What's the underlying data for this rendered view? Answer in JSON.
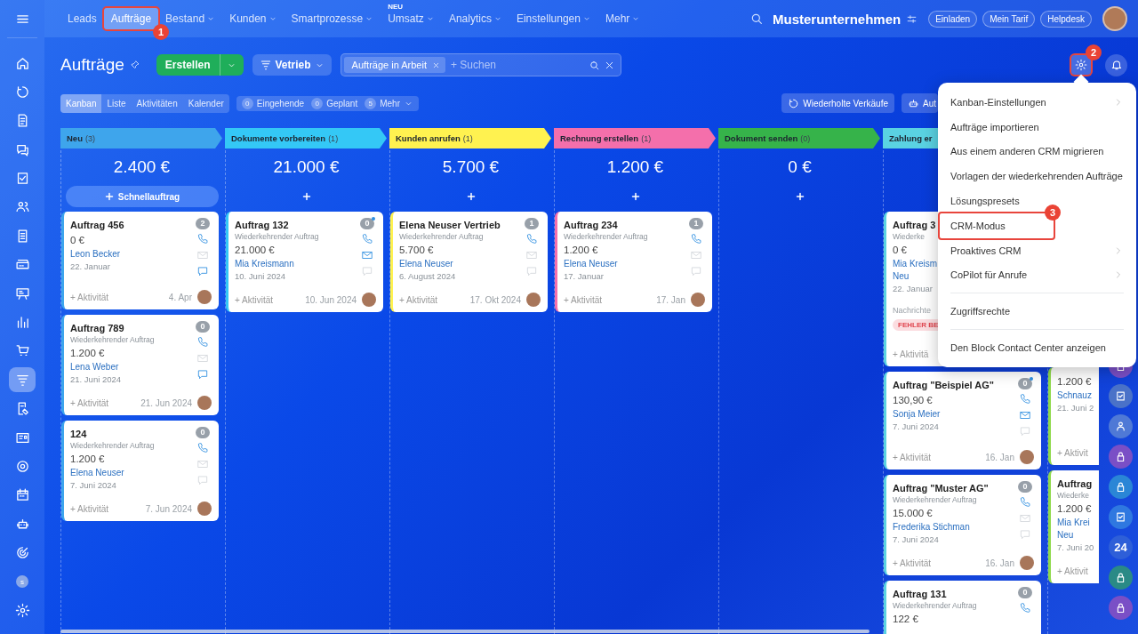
{
  "nav": {
    "items": [
      {
        "label": "Leads",
        "selected": false,
        "dropdown": false
      },
      {
        "label": "Aufträge",
        "selected": true,
        "dropdown": false,
        "callout": "1"
      },
      {
        "label": "Bestand",
        "selected": false,
        "dropdown": true
      },
      {
        "label": "Kunden",
        "selected": false,
        "dropdown": true
      },
      {
        "label": "Smartprozesse",
        "selected": false,
        "dropdown": true
      },
      {
        "label": "Umsatz",
        "selected": false,
        "dropdown": true,
        "badge": "NEU"
      },
      {
        "label": "Analytics",
        "selected": false,
        "dropdown": true
      },
      {
        "label": "Einstellungen",
        "selected": false,
        "dropdown": true
      },
      {
        "label": "Mehr",
        "selected": false,
        "dropdown": true
      }
    ],
    "company": "Musterunternehmen",
    "buttons": [
      "Einladen",
      "Mein Tarif",
      "Helpdesk"
    ]
  },
  "sidebar": {
    "items": [
      {
        "kind": "home",
        "selected": false
      },
      {
        "kind": "cycle",
        "selected": false
      },
      {
        "kind": "document",
        "selected": false
      },
      {
        "kind": "chat",
        "selected": false
      },
      {
        "kind": "checkbox",
        "selected": false
      },
      {
        "kind": "people",
        "selected": false
      },
      {
        "kind": "page",
        "selected": false
      },
      {
        "kind": "drive",
        "selected": false
      },
      {
        "kind": "board",
        "selected": false
      },
      {
        "kind": "chart",
        "selected": false
      },
      {
        "kind": "cart",
        "selected": false
      },
      {
        "kind": "funnel",
        "selected": true
      },
      {
        "kind": "edit",
        "selected": false
      },
      {
        "kind": "contact",
        "selected": false
      },
      {
        "kind": "ring",
        "selected": false
      },
      {
        "kind": "calendar",
        "selected": false
      },
      {
        "kind": "robot",
        "selected": false
      },
      {
        "kind": "target",
        "selected": false
      },
      {
        "kind": "initial",
        "selected": false,
        "text": "s"
      },
      {
        "kind": "settings",
        "selected": false
      }
    ]
  },
  "page": {
    "title": "Aufträge",
    "create": "Erstellen",
    "pipeline": "Vetrieb",
    "filter_chip": "Aufträge in Arbeit",
    "search": {
      "placeholder": "+ Suchen"
    },
    "settings_callout": "2"
  },
  "views": [
    {
      "label": "Kanban",
      "selected": true
    },
    {
      "label": "Liste",
      "selected": false
    },
    {
      "label": "Aktivitäten",
      "selected": false
    },
    {
      "label": "Kalender",
      "selected": false
    }
  ],
  "counters": [
    {
      "count": "0",
      "label": "Eingehende",
      "dropdown": false
    },
    {
      "count": "0",
      "label": "Geplant",
      "dropdown": false
    },
    {
      "count": "5",
      "label": "Mehr",
      "dropdown": true
    }
  ],
  "actions": [
    {
      "kind": "cycle",
      "label": "Wiederholte Verkäufe"
    },
    {
      "kind": "robot",
      "label": "Aut"
    }
  ],
  "columns": [
    {
      "title": "Neu",
      "count": "(3)",
      "color": "#3ea5ec",
      "total": "2.400 €",
      "add": {
        "kind": "quick",
        "label": "Schnellauftrag"
      },
      "cards": [
        {
          "title": "Auftrag 456",
          "amount": "0 €",
          "contacts": [
            "Leon Becker"
          ],
          "date": "22. Januar",
          "activity": "+ Aktivität",
          "due": "4. Apr",
          "count": "2",
          "unread": false,
          "avatar": true,
          "channels": [
            {
              "kind": "phone",
              "active": true
            },
            {
              "kind": "mail",
              "active": false
            },
            {
              "kind": "chat",
              "active": true
            }
          ]
        },
        {
          "title": "Auftrag 789",
          "subtitle": "Wiederkehrender Auftrag",
          "amount": "1.200 €",
          "contacts": [
            "Lena Weber"
          ],
          "date": "21. Juni 2024",
          "activity": "+ Aktivität",
          "due": "21. Jun 2024",
          "count": "0",
          "unread": false,
          "avatar": true,
          "channels": [
            {
              "kind": "phone",
              "active": true
            },
            {
              "kind": "mail",
              "active": false
            },
            {
              "kind": "chat",
              "active": true
            }
          ]
        },
        {
          "title": "124",
          "subtitle": "Wiederkehrender Auftrag",
          "amount": "1.200 €",
          "contacts": [
            "Elena Neuser"
          ],
          "date": "7. Juni 2024",
          "activity": "+ Aktivität",
          "due": "7. Jun 2024",
          "count": "0",
          "unread": false,
          "avatar": true,
          "channels": [
            {
              "kind": "phone",
              "active": true
            },
            {
              "kind": "mail",
              "active": false
            },
            {
              "kind": "chat",
              "active": false
            }
          ]
        }
      ]
    },
    {
      "title": "Dokumente vorbereiten",
      "count": "(1)",
      "color": "#34c8f6",
      "total": "21.000 €",
      "add": {
        "kind": "plus"
      },
      "cards": [
        {
          "title": "Auftrag 132",
          "subtitle": "Wiederkehrender Auftrag",
          "amount": "21.000 €",
          "contacts": [
            "Mia Kreismann"
          ],
          "date": "10. Juni 2024",
          "activity": "+ Aktivität",
          "due": "10. Jun 2024",
          "count": "0",
          "unread": true,
          "avatar": true,
          "channels": [
            {
              "kind": "phone",
              "active": true
            },
            {
              "kind": "mail",
              "active": true
            },
            {
              "kind": "chat",
              "active": false
            }
          ]
        }
      ]
    },
    {
      "title": "Kunden anrufen",
      "count": "(1)",
      "color": "#fff250",
      "total": "5.700 €",
      "add": {
        "kind": "plus"
      },
      "cards": [
        {
          "title": "Elena Neuser Vertrieb",
          "subtitle": "Wiederkehrender Auftrag",
          "amount": "5.700 €",
          "contacts": [
            "Elena Neuser"
          ],
          "date": "6. August 2024",
          "activity": "+ Aktivität",
          "due": "17. Okt 2024",
          "count": "1",
          "unread": false,
          "avatar": true,
          "channels": [
            {
              "kind": "phone",
              "active": true
            },
            {
              "kind": "mail",
              "active": false
            },
            {
              "kind": "chat",
              "active": false
            }
          ]
        }
      ]
    },
    {
      "title": "Rechnung erstellen",
      "count": "(1)",
      "color": "#f46fab",
      "total": "1.200 €",
      "add": {
        "kind": "plus"
      },
      "cards": [
        {
          "title": "Auftrag 234",
          "subtitle": "Wiederkehrender Auftrag",
          "amount": "1.200 €",
          "contacts": [
            "Elena Neuser"
          ],
          "date": "17. Januar",
          "activity": "+ Aktivität",
          "due": "17. Jan",
          "count": "1",
          "unread": false,
          "avatar": true,
          "channels": [
            {
              "kind": "phone",
              "active": true
            },
            {
              "kind": "mail",
              "active": false
            },
            {
              "kind": "chat",
              "active": false
            }
          ]
        }
      ]
    },
    {
      "title": "Dokument senden",
      "count": "(0)",
      "color": "#36b34a",
      "total": "0 €",
      "add": {
        "kind": "plus"
      }
    },
    {
      "title": "Zahlung er",
      "color": "#5ad2e2",
      "cards": [
        {
          "title": "Auftrag 3",
          "subtitle": "Wiederke",
          "amount": "0 €",
          "contacts": [
            "Mia Kreism",
            "Neu"
          ],
          "date": "22. Januar",
          "note": "Nachrichte",
          "tag": "FEHLER BE",
          "activity": "+ Aktivitä"
        },
        {
          "title": "Auftrag \"Beispiel AG\"",
          "amount": "130,90 €",
          "contacts": [
            "Sonja Meier"
          ],
          "date": "7. Juni 2024",
          "activity": "+ Aktivität",
          "due": "16. Jan",
          "count": "0",
          "unread": true,
          "avatar": true,
          "channels": [
            {
              "kind": "phone",
              "active": true
            },
            {
              "kind": "mail",
              "active": true
            },
            {
              "kind": "chat",
              "active": false
            }
          ]
        },
        {
          "title": "Auftrag \"Muster AG\"",
          "subtitle": "Wiederkehrender Auftrag",
          "amount": "15.000 €",
          "contacts": [
            "Frederika Stichman"
          ],
          "date": "7. Juni 2024",
          "activity": "+ Aktivität",
          "due": "16. Jan",
          "count": "0",
          "unread": false,
          "avatar": true,
          "channels": [
            {
              "kind": "phone",
              "active": true
            },
            {
              "kind": "mail",
              "active": false
            },
            {
              "kind": "chat",
              "active": false
            }
          ]
        },
        {
          "title": "Auftrag 131",
          "subtitle": "Wiederkehrender Auftrag",
          "amount": "122 €",
          "count": "0",
          "unread": false,
          "channels": [
            {
              "kind": "phone",
              "active": true
            }
          ]
        }
      ]
    },
    {
      "color": "#8fd94a",
      "cards": [
        {
          "amount": "1.200 €",
          "contacts": [
            "Schnauz"
          ],
          "date": "21. Juni 2",
          "activity": "+ Aktivit"
        },
        {
          "title": "Auftrag",
          "subtitle": "Wiederke",
          "amount": "1.200 €",
          "contacts": [
            "Mia Krei",
            "Neu"
          ],
          "date": "7. Juni 20",
          "activity": "+ Aktivit"
        }
      ]
    }
  ],
  "menu": {
    "items": [
      {
        "label": "Kanban-Einstellungen",
        "submenu": true,
        "divider_before": false
      },
      {
        "label": "Aufträge importieren",
        "submenu": false,
        "divider_before": false
      },
      {
        "label": "Aus einem anderen CRM migrieren",
        "submenu": false,
        "divider_before": false
      },
      {
        "label": "Vorlagen der wiederkehrenden Aufträge",
        "submenu": false,
        "divider_before": false
      },
      {
        "label": "Lösungspresets",
        "submenu": false,
        "divider_before": false
      },
      {
        "label": "CRM-Modus",
        "submenu": false,
        "divider_before": false,
        "callout": "3"
      },
      {
        "label": "Proaktives CRM",
        "submenu": true,
        "divider_before": false
      },
      {
        "label": "CoPilot für Anrufe",
        "submenu": true,
        "divider_before": false
      },
      {
        "label": "Zugriffsrechte",
        "submenu": false,
        "divider_before": true
      },
      {
        "label": "Den Block Contact Center anzeigen",
        "submenu": false,
        "divider_before": true
      }
    ]
  },
  "right_rail": [
    {
      "kind": "lock",
      "color": "#7a4fc6"
    },
    {
      "kind": "check",
      "color": "#4a72c8"
    },
    {
      "kind": "figure",
      "color": "#4f79d6"
    },
    {
      "kind": "lock",
      "color": "#7a4fc6"
    },
    {
      "kind": "lock",
      "color": "#2a86d6"
    },
    {
      "kind": "check",
      "color": "#2f78e0"
    },
    {
      "kind": "text",
      "color": "#2e5fd8",
      "text": "24"
    },
    {
      "kind": "lock",
      "color": "#2a8a86"
    },
    {
      "kind": "lock",
      "color": "#7a4fc6"
    }
  ]
}
